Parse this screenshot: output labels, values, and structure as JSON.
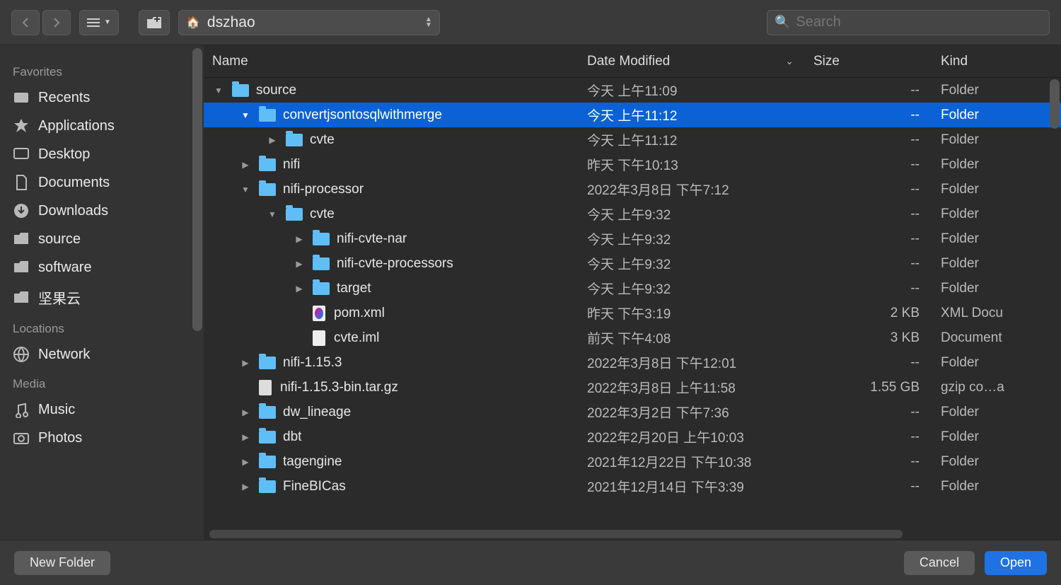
{
  "toolbar": {
    "path_label": "dszhao",
    "search_placeholder": "Search"
  },
  "sidebar": {
    "favorites_heading": "Favorites",
    "locations_heading": "Locations",
    "media_heading": "Media",
    "items": {
      "recents": "Recents",
      "applications": "Applications",
      "desktop": "Desktop",
      "documents": "Documents",
      "downloads": "Downloads",
      "source": "source",
      "software": "software",
      "nutcloud": "坚果云",
      "network": "Network",
      "music": "Music",
      "photos": "Photos"
    }
  },
  "columns": {
    "name": "Name",
    "date": "Date Modified",
    "size": "Size",
    "kind": "Kind"
  },
  "rows": [
    {
      "indent": 0,
      "arrow": "down",
      "icon": "folder",
      "name": "source",
      "date": "今天 上午11:09",
      "size": "--",
      "kind": "Folder",
      "selected": false
    },
    {
      "indent": 1,
      "arrow": "down",
      "icon": "folder",
      "name": "convertjsontosqlwithmerge",
      "date": "今天 上午11:12",
      "size": "--",
      "kind": "Folder",
      "selected": true
    },
    {
      "indent": 2,
      "arrow": "right",
      "icon": "folder",
      "name": "cvte",
      "date": "今天 上午11:12",
      "size": "--",
      "kind": "Folder",
      "selected": false
    },
    {
      "indent": 1,
      "arrow": "right",
      "icon": "folder",
      "name": "nifi",
      "date": "昨天 下午10:13",
      "size": "--",
      "kind": "Folder",
      "selected": false
    },
    {
      "indent": 1,
      "arrow": "down",
      "icon": "folder",
      "name": "nifi-processor",
      "date": "2022年3月8日 下午7:12",
      "size": "--",
      "kind": "Folder",
      "selected": false
    },
    {
      "indent": 2,
      "arrow": "down",
      "icon": "folder",
      "name": "cvte",
      "date": "今天 上午9:32",
      "size": "--",
      "kind": "Folder",
      "selected": false
    },
    {
      "indent": 3,
      "arrow": "right",
      "icon": "folder",
      "name": "nifi-cvte-nar",
      "date": "今天 上午9:32",
      "size": "--",
      "kind": "Folder",
      "selected": false
    },
    {
      "indent": 3,
      "arrow": "right",
      "icon": "folder",
      "name": "nifi-cvte-processors",
      "date": "今天 上午9:32",
      "size": "--",
      "kind": "Folder",
      "selected": false
    },
    {
      "indent": 3,
      "arrow": "right",
      "icon": "folder",
      "name": "target",
      "date": "今天 上午9:32",
      "size": "--",
      "kind": "Folder",
      "selected": false
    },
    {
      "indent": 3,
      "arrow": "",
      "icon": "xml",
      "name": "pom.xml",
      "date": "昨天 下午3:19",
      "size": "2 KB",
      "kind": "XML Docu",
      "selected": false
    },
    {
      "indent": 3,
      "arrow": "",
      "icon": "file",
      "name": "cvte.iml",
      "date": "前天 下午4:08",
      "size": "3 KB",
      "kind": "Document",
      "selected": false
    },
    {
      "indent": 1,
      "arrow": "right",
      "icon": "folder",
      "name": "nifi-1.15.3",
      "date": "2022年3月8日 下午12:01",
      "size": "--",
      "kind": "Folder",
      "selected": false
    },
    {
      "indent": 1,
      "arrow": "",
      "icon": "gz",
      "name": "nifi-1.15.3-bin.tar.gz",
      "date": "2022年3月8日 上午11:58",
      "size": "1.55 GB",
      "kind": "gzip co…a",
      "selected": false
    },
    {
      "indent": 1,
      "arrow": "right",
      "icon": "folder",
      "name": "dw_lineage",
      "date": "2022年3月2日 下午7:36",
      "size": "--",
      "kind": "Folder",
      "selected": false
    },
    {
      "indent": 1,
      "arrow": "right",
      "icon": "folder",
      "name": "dbt",
      "date": "2022年2月20日 上午10:03",
      "size": "--",
      "kind": "Folder",
      "selected": false
    },
    {
      "indent": 1,
      "arrow": "right",
      "icon": "folder",
      "name": "tagengine",
      "date": "2021年12月22日 下午10:38",
      "size": "--",
      "kind": "Folder",
      "selected": false
    },
    {
      "indent": 1,
      "arrow": "right",
      "icon": "folder",
      "name": "FineBICas",
      "date": "2021年12月14日 下午3:39",
      "size": "--",
      "kind": "Folder",
      "selected": false
    }
  ],
  "footer": {
    "new_folder": "New Folder",
    "cancel": "Cancel",
    "open": "Open"
  }
}
